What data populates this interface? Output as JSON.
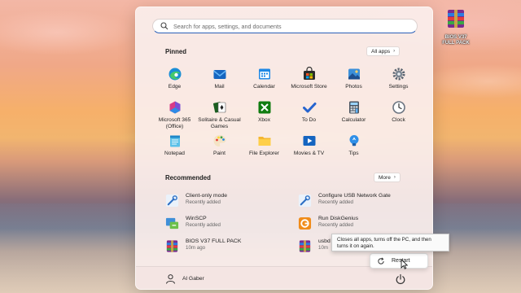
{
  "desktop": {
    "icon_label": "BIOS V37 FULL PACK"
  },
  "start_menu": {
    "search_placeholder": "Search for apps, settings, and documents",
    "pinned_title": "Pinned",
    "all_apps_label": "All apps",
    "pinned_apps": [
      {
        "label": "Edge",
        "icon": "edge-icon"
      },
      {
        "label": "Mail",
        "icon": "mail-icon"
      },
      {
        "label": "Calendar",
        "icon": "calendar-icon"
      },
      {
        "label": "Microsoft Store",
        "icon": "store-icon"
      },
      {
        "label": "Photos",
        "icon": "photos-icon"
      },
      {
        "label": "Settings",
        "icon": "settings-gear-icon"
      },
      {
        "label": "Microsoft 365 (Office)",
        "icon": "office-icon"
      },
      {
        "label": "Solitaire & Casual Games",
        "icon": "solitaire-icon"
      },
      {
        "label": "Xbox",
        "icon": "xbox-icon"
      },
      {
        "label": "To Do",
        "icon": "todo-check-icon"
      },
      {
        "label": "Calculator",
        "icon": "calculator-icon"
      },
      {
        "label": "Clock",
        "icon": "clock-icon"
      },
      {
        "label": "Notepad",
        "icon": "notepad-icon"
      },
      {
        "label": "Paint",
        "icon": "paint-palette-icon"
      },
      {
        "label": "File Explorer",
        "icon": "folder-icon"
      },
      {
        "label": "Movies & TV",
        "icon": "movies-tv-icon"
      },
      {
        "label": "Tips",
        "icon": "lightbulb-icon"
      }
    ],
    "recommended_title": "Recommended",
    "more_label": "More",
    "recommended": [
      {
        "name": "Client-only mode",
        "sub": "Recently added",
        "icon": "settings-tool-icon"
      },
      {
        "name": "Configure USB Network Gate",
        "sub": "Recently added",
        "icon": "settings-tool-icon"
      },
      {
        "name": "WinSCP",
        "sub": "Recently added",
        "icon": "winscp-icon"
      },
      {
        "name": "Run DiskGenius",
        "sub": "Recently added",
        "icon": "diskgenius-icon"
      },
      {
        "name": "BIOS V37 FULL PACK",
        "sub": "10m ago",
        "icon": "winrar-archive-icon"
      },
      {
        "name": "usbd",
        "sub": "10m",
        "icon": "winrar-archive-icon"
      }
    ],
    "user_name": "Al Gaber",
    "power_icon": "power-icon"
  },
  "power_menu": {
    "restart_label": "Restart",
    "restart_tooltip": "Closes all apps, turns off the PC, and then turns it on again."
  },
  "colors": {
    "accent": "#2b5fb8",
    "menu_bg": "#faeeec"
  }
}
